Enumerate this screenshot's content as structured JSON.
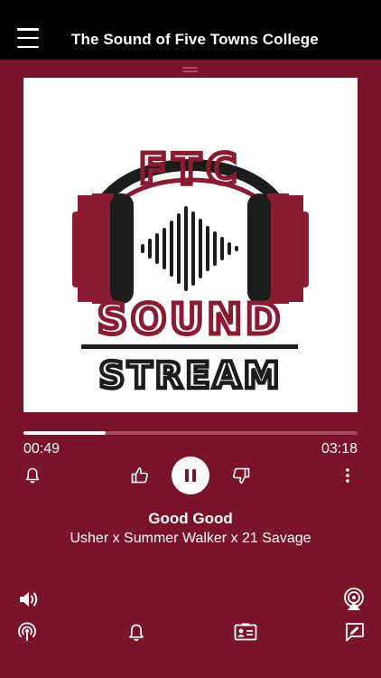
{
  "header": {
    "title": "The Sound of Five Towns College",
    "menu_icon": "hamburger-menu-icon"
  },
  "artwork": {
    "logo_top": "FTC",
    "logo_mid": "SOUND",
    "logo_bottom": "STREAM",
    "colors": {
      "primary": "#8a1c32",
      "dark": "#1c1c1c"
    }
  },
  "player": {
    "elapsed": "00:49",
    "duration": "03:18",
    "progress_fraction": 0.247,
    "state": "playing",
    "controls": {
      "alarm_icon": "bell-icon",
      "like_icon": "thumbs-up-icon",
      "pause_icon": "pause-icon",
      "dislike_icon": "thumbs-down-icon",
      "more_icon": "more-vertical-icon"
    }
  },
  "track": {
    "title": "Good Good",
    "artist": "Usher x Summer Walker x 21 Savage"
  },
  "bottom": {
    "icons": [
      "volume-icon",
      "airplay-icon",
      "podcast-icon",
      "bell-icon",
      "contact-card-icon",
      "feedback-icon"
    ]
  },
  "colors": {
    "background": "#7a1428",
    "topbar": "#000000",
    "accent": "#ffffff"
  }
}
